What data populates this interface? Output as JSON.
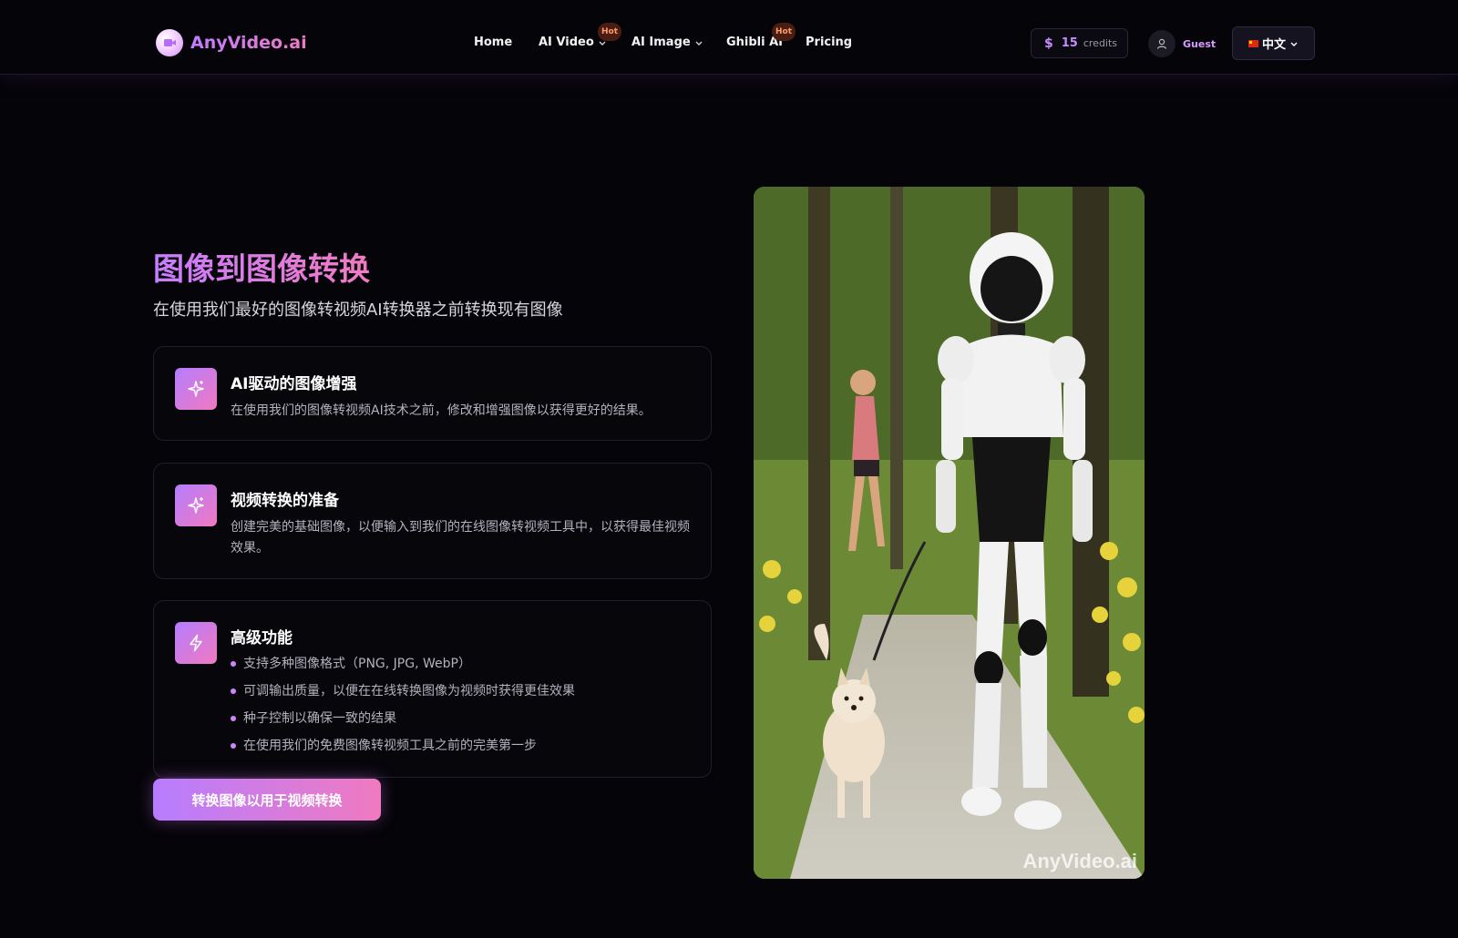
{
  "header": {
    "logo_text": "AnyVideo.ai",
    "nav": [
      {
        "label": "Home",
        "has_dropdown": false,
        "badge": ""
      },
      {
        "label": "AI Video",
        "has_dropdown": true,
        "badge": "Hot"
      },
      {
        "label": "AI Image",
        "has_dropdown": true,
        "badge": ""
      },
      {
        "label": "Ghibli AI",
        "has_dropdown": false,
        "badge": "Hot"
      },
      {
        "label": "Pricing",
        "has_dropdown": false,
        "badge": ""
      }
    ],
    "credits": {
      "symbol": "$",
      "amount": "15",
      "label": "credits"
    },
    "user": {
      "name": "Guest"
    },
    "language": {
      "label": "中文"
    }
  },
  "hero": {
    "title": "图像到图像转换",
    "subtitle": "在使用我们最好的图像转视频AI转换器之前转换现有图像",
    "features": [
      {
        "icon": "sparkles-icon",
        "title": "AI驱动的图像增强",
        "description": "在使用我们的图像转视频AI技术之前，修改和增强图像以获得更好的结果。"
      },
      {
        "icon": "sparkles-icon",
        "title": "视频转换的准备",
        "description": "创建完美的基础图像，以便输入到我们的在线图像转视频工具中，以获得最佳视频效果。"
      },
      {
        "icon": "lightning-icon",
        "title": "高级功能",
        "bullets": [
          "支持多种图像格式（PNG, JPG, WebP）",
          "可调输出质量，以便在在线转换图像为视频时获得更佳效果",
          "种子控制以确保一致的结果",
          "在使用我们的免费图像转视频工具之前的完美第一步"
        ]
      }
    ],
    "cta_label": "转换图像以用于视频转换",
    "image_watermark": "AnyVideo.ai"
  },
  "colors": {
    "background": "#050408",
    "accent_start": "#b77dff",
    "accent_end": "#f07ac0",
    "hot_badge_bg": "#4a1d12",
    "hot_badge_text": "#ff9a6a"
  }
}
